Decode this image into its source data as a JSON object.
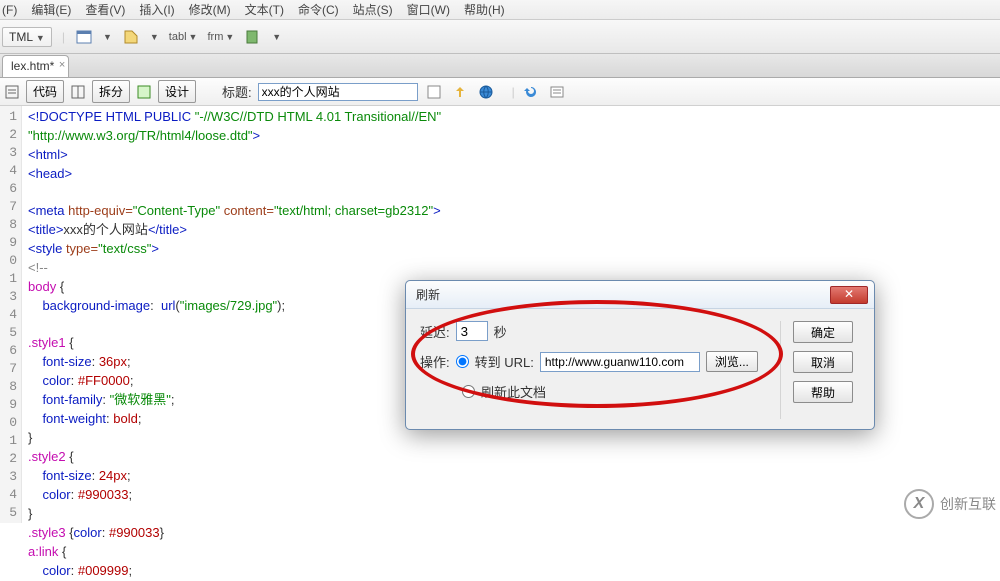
{
  "menu": {
    "file": "(F)",
    "edit": "编辑(E)",
    "view": "查看(V)",
    "insert": "插入(I)",
    "modify": "修改(M)",
    "text": "文本(T)",
    "command": "命令(C)",
    "site": "站点(S)",
    "window": "窗口(W)",
    "help": "帮助(H)"
  },
  "toolbar": {
    "format_label": "TML",
    "tabl": "tabl",
    "frm": "frm"
  },
  "tab": {
    "filename": "lex.htm*"
  },
  "views": {
    "code": "代码",
    "split": "拆分",
    "design": "设计"
  },
  "title_field": {
    "label": "标题:",
    "value": "xxx的个人网站"
  },
  "code": {
    "l1a": "<!DOCTYPE HTML PUBLIC ",
    "l1b": "\"-//W3C//DTD HTML 4.01 Transitional//EN\"",
    "l2": "\"http://www.w3.org/TR/html4/loose.dtd\"",
    "l2b": ">",
    "l3": "<html>",
    "l4": "<head>",
    "l6a": "<meta",
    "l6b": " http-equiv=",
    "l6c": "\"Content-Type\"",
    "l6d": " content=",
    "l6e": "\"text/html; charset=gb2312\"",
    "l6f": ">",
    "l7a": "<title>",
    "l7b": "xxx的个人网站",
    "l7c": "</title>",
    "l8a": "<style",
    "l8b": " type=",
    "l8c": "\"text/css\"",
    "l8d": ">",
    "l9": "<!--",
    "l10": "body",
    "l10b": " {",
    "l11a": "    background-image",
    "l11b": ":  ",
    "l11c": "url",
    "l11d": "(",
    "l11e": "\"images/729.jpg\"",
    "l11f": ");",
    "l13": ".style1",
    "l13b": " {",
    "l14a": "    font-size",
    "l14b": ": ",
    "l14c": "36px",
    "l14d": ";",
    "l15a": "    color",
    "l15b": ": ",
    "l15c": "#FF0000",
    "l15d": ";",
    "l16a": "    font-family",
    "l16b": ": ",
    "l16c": "\"微软雅黑\"",
    "l16d": ";",
    "l17a": "    font-weight",
    "l17b": ": ",
    "l17c": "bold",
    "l17d": ";",
    "l18": "}",
    "l19": ".style2",
    "l19b": " {",
    "l20a": "    font-size",
    "l20b": ": ",
    "l20c": "24px",
    "l20d": ";",
    "l21a": "    color",
    "l21b": ": ",
    "l21c": "#990033",
    "l21d": ";",
    "l22": "}",
    "l23a": ".style3",
    "l23b": " {",
    "l23c": "color",
    "l23d": ": ",
    "l23e": "#990033",
    "l23f": "}",
    "l24a": "a:link",
    "l24b": " {",
    "l25a": "    color",
    "l25b": ": ",
    "l25c": "#009999",
    "l25d": ";"
  },
  "dialog": {
    "title": "刷新",
    "delay_label": "延迟:",
    "delay_value": "3",
    "seconds": "秒",
    "action_label": "操作:",
    "goto_url": "转到 URL:",
    "url_value": "http://www.guanw110.com",
    "browse": "浏览...",
    "refresh_doc": "刷新此文档",
    "ok": "确定",
    "cancel": "取消",
    "help": "帮助"
  },
  "watermark": {
    "text": "创新互联",
    "logo": "X"
  }
}
